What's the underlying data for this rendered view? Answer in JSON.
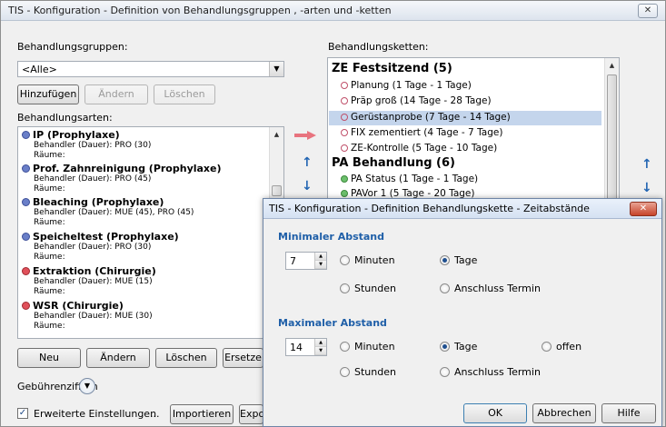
{
  "window": {
    "title": "TIS - Konfiguration - Definition von Behandlungsgruppen , -arten und -ketten",
    "close_glyph": "✕"
  },
  "gruppen": {
    "label": "Behandlungsgruppen:",
    "selected": "<Alle>",
    "buttons": {
      "add": "Hinzufügen",
      "edit": "Ändern",
      "delete": "Löschen"
    }
  },
  "arten": {
    "label": "Behandlungsarten:",
    "items": [
      {
        "name": "IP (Prophylaxe)",
        "behandler": "Behandler (Dauer): PRO (30)",
        "raeume": "Räume:",
        "color": "#6a7fc8"
      },
      {
        "name": "Prof. Zahnreinigung (Prophylaxe)",
        "behandler": "Behandler (Dauer): PRO (45)",
        "raeume": "Räume:",
        "color": "#6a7fc8"
      },
      {
        "name": "Bleaching (Prophylaxe)",
        "behandler": "Behandler (Dauer): MUE (45), PRO (45)",
        "raeume": "Räume:",
        "color": "#6a7fc8"
      },
      {
        "name": "Speicheltest (Prophylaxe)",
        "behandler": "Behandler (Dauer): PRO (30)",
        "raeume": "Räume:",
        "color": "#6a7fc8"
      },
      {
        "name": "Extraktion (Chirurgie)",
        "behandler": "Behandler (Dauer): MUE (15)",
        "raeume": "Räume:",
        "color": "#e0505a"
      },
      {
        "name": "WSR (Chirurgie)",
        "behandler": "Behandler (Dauer): MUE (30)",
        "raeume": "Räume:",
        "color": "#e0505a"
      }
    ],
    "buttons": {
      "new": "Neu",
      "edit": "Ändern",
      "delete": "Löschen",
      "replace": "Ersetze"
    }
  },
  "gebuehren": {
    "label": "Gebührenziffern"
  },
  "extended": {
    "label": "Erweiterte Einstellungen",
    "checked": true,
    "more": "...",
    "import": "Importieren",
    "export": "Expo"
  },
  "ketten": {
    "label": "Behandlungsketten:",
    "groups": [
      {
        "title": "ZE Festsitzend (5)",
        "color": "#c0506a",
        "items": [
          "Planung (1 Tage - 1 Tage)",
          "Präp groß (14 Tage - 28 Tage)",
          "Gerüstanprobe (7 Tage - 14 Tage)",
          "FIX zementiert (4 Tage - 7 Tage)",
          "ZE-Kontrolle (5 Tage - 10 Tage)"
        ],
        "selected_index": 2
      },
      {
        "title": "PA Behandlung (6)",
        "color": "#4aa84a",
        "items": [
          "PA Status (1 Tage - 1 Tage)",
          "PAVor 1 (5 Tage - 20 Tage)"
        ]
      }
    ]
  },
  "dialog": {
    "title": "TIS - Konfiguration - Definition Behandlungskette - Zeitabstände",
    "close_glyph": "✕",
    "min": {
      "heading": "Minimaler Abstand",
      "value": "7",
      "options": {
        "minuten": "Minuten",
        "tage": "Tage",
        "stunden": "Stunden",
        "anschluss": "Anschluss Termin"
      },
      "selected": "tage"
    },
    "max": {
      "heading": "Maximaler Abstand",
      "value": "14",
      "options": {
        "minuten": "Minuten",
        "tage": "Tage",
        "offen": "offen",
        "stunden": "Stunden",
        "anschluss": "Anschluss Termin"
      },
      "selected": "tage"
    },
    "buttons": {
      "ok": "OK",
      "cancel": "Abbrechen",
      "help": "Hilfe"
    }
  }
}
